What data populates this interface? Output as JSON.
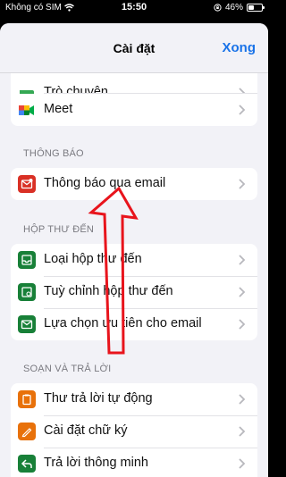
{
  "status_bar": {
    "carrier": "Không có SIM",
    "time": "15:50",
    "battery": "46%",
    "battery_level": 0.46
  },
  "nav": {
    "title": "Cài đặt",
    "done_label": "Xong"
  },
  "top_group": {
    "items": [
      {
        "label": "Trò chuyện",
        "icon": "chat-icon",
        "color": "#34a853"
      },
      {
        "label": "Meet",
        "icon": "meet-icon",
        "color": "#00832d"
      }
    ]
  },
  "sections": [
    {
      "header": "THÔNG BÁO",
      "items": [
        {
          "label": "Thông báo qua email",
          "icon": "mail-notification-icon",
          "color": "#d93025"
        }
      ]
    },
    {
      "header": "HỘP THƯ ĐẾN",
      "items": [
        {
          "label": "Loại hộp thư đến",
          "icon": "inbox-icon",
          "color": "#188038"
        },
        {
          "label": "Tuỳ chỉnh hộp thư đến",
          "icon": "inbox-settings-icon",
          "color": "#188038"
        },
        {
          "label": "Lựa chọn ưu tiên cho email",
          "icon": "mail-icon",
          "color": "#188038"
        }
      ]
    },
    {
      "header": "SOẠN VÀ TRẢ LỜI",
      "items": [
        {
          "label": "Thư trả lời tự động",
          "icon": "auto-reply-icon",
          "color": "#e8710a"
        },
        {
          "label": "Cài đặt chữ ký",
          "icon": "signature-icon",
          "color": "#e8710a"
        },
        {
          "label": "Trả lời thông minh",
          "icon": "smart-reply-icon",
          "color": "#188038"
        }
      ]
    }
  ],
  "annotation": {
    "arrow_color": "#e8141c"
  }
}
